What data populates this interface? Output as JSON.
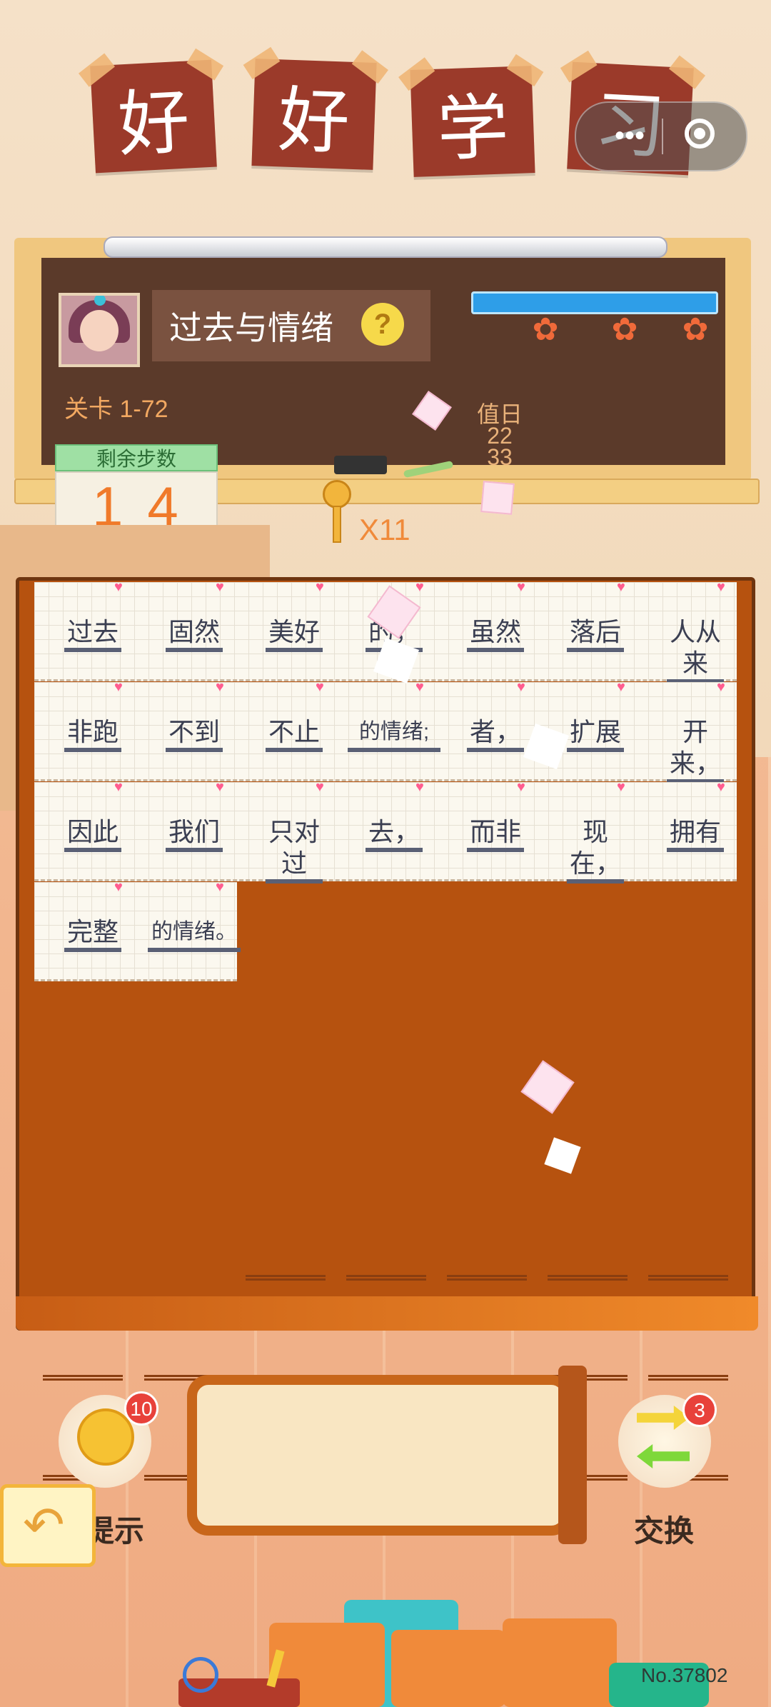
{
  "title": {
    "chars": [
      "好",
      "好",
      "学",
      "习"
    ]
  },
  "system": {
    "capsule_dots": "•••"
  },
  "board": {
    "topic": "过去与情绪",
    "help_icon": "?",
    "level": "关卡 1-72",
    "progress_fraction": 1.0,
    "chalk_writing": [
      "值日",
      "22",
      "33"
    ]
  },
  "steps": {
    "label": "剩余步数",
    "value": "14"
  },
  "keys": {
    "count": "X11"
  },
  "puzzle": {
    "rows": [
      [
        "过去",
        "固然",
        "美好",
        "的，",
        "虽然",
        "落后",
        "人从来"
      ],
      [
        "非跑",
        "不到",
        "不止",
        "的情绪;",
        "者，",
        "扩展",
        "开来，"
      ],
      [
        "因此",
        "我们",
        "只对过",
        "去，",
        "而非",
        "现在，",
        "拥有"
      ],
      [
        "完整",
        "的情绪。"
      ]
    ]
  },
  "controls": {
    "hint_label": "提示",
    "hint_count": "10",
    "swap_label": "交换",
    "swap_count": "3",
    "back_icon": "back-arrow-icon"
  },
  "footer": {
    "number": "No.37802"
  },
  "colors": {
    "board": "#5b3a2a",
    "panel": "#b6520f",
    "title_tile": "#9b3a2a",
    "accent": "#f07a2a"
  }
}
